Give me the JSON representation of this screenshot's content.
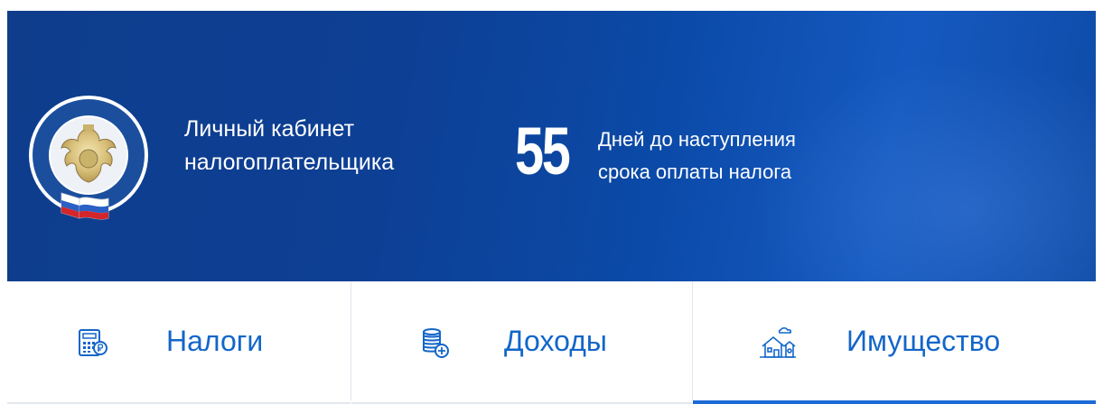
{
  "header": {
    "brand_line1": "Личный кабинет",
    "brand_line2": "налогоплательщика",
    "days_count": "55",
    "days_line1": "Дней до наступления",
    "days_line2": "срока оплаты налога",
    "emblem_icon": "fns-emblem-icon",
    "background_color": "#0d3f94"
  },
  "tabs": [
    {
      "label": "Налоги",
      "icon": "calculator-icon",
      "active": false
    },
    {
      "label": "Доходы",
      "icon": "coins-stack-icon",
      "active": false
    },
    {
      "label": "Имущество",
      "icon": "house-icon",
      "active": true
    }
  ],
  "colors": {
    "tab_text": "#1366c9",
    "active_underline": "#1a6ad6"
  }
}
